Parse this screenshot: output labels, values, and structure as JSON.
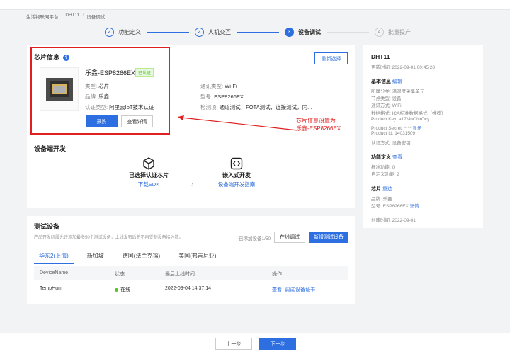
{
  "breadcrumb": [
    "生活物联网平台",
    "DHT11",
    "设备调试"
  ],
  "steps": [
    {
      "label": "功能定义",
      "num": "✓"
    },
    {
      "label": "人机交互",
      "num": "✓"
    },
    {
      "label": "设备调试",
      "num": "3"
    },
    {
      "label": "批量投产",
      "num": "4"
    }
  ],
  "chip": {
    "title": "芯片信息",
    "name": "乐鑫-ESP8266EX",
    "badge": "已认证",
    "type": "类型: ",
    "type_v": "芯片",
    "brand": "品牌: ",
    "brand_v": "乐鑫",
    "cert": "认证类型: ",
    "cert_v": "阿里云IoT技术认证",
    "comm": "通讯类型: ",
    "comm_v": "Wi-Fi",
    "model": "型号: ",
    "model_v": "ESP8266EX",
    "test": "检测项: ",
    "test_v": "通道测试，FOTA测试，连接测试，内...",
    "buy": "采购",
    "detail": "查看详情",
    "reselect": "重新选择"
  },
  "annotation": [
    "芯片信息设置为",
    "乐鑫-ESP8266EX"
  ],
  "dev": {
    "title": "设备端开发",
    "opt1_title": "已选择认证芯片",
    "opt1_link": "下载SDK",
    "opt2_title": "嵌入式开发",
    "opt2_link": "设备端开发指南"
  },
  "test": {
    "title": "测试设备",
    "desc": "产品开发阶段允许添加最多50个测试设备，上线发布后将不再受制设备接入数。",
    "count": "已添加设备1/50",
    "online_btn": "在线调试",
    "add_btn": "新增测试设备",
    "tabs": [
      "华东2(上海)",
      "新加坡",
      "德国(法兰克福)",
      "美国(弗吉尼亚)"
    ],
    "headers": [
      "DeviceName",
      "状态",
      "最后上线时间",
      "操作"
    ],
    "row": {
      "name": "TempHum",
      "status": "在线",
      "time": "2022-09-04 14:37:14",
      "ops": [
        "查看",
        "调试",
        "设备证书"
      ]
    }
  },
  "side": {
    "title": "DHT11",
    "updated": "更新时间: 2022-09-01 00:45:28",
    "basic": "基本信息",
    "edit": "编辑",
    "lines": [
      "所属分类: 温湿度采集单元",
      "节点类型: 设备",
      "通讯方式: WiFi",
      "数据格式: ICA标准数据格式（推荐）",
      "Product Key: a17MnONrOcy",
      "Product Secret: ****",
      "Product Id: 14031509",
      "认证方式: 设备密钥"
    ],
    "show": "显示",
    "func": "功能定义",
    "view": "查看",
    "func_lines": [
      "标准功能: 0",
      "自定义功能: 2"
    ],
    "chip": "芯片",
    "reselect": "重选",
    "chip_lines": [
      "品牌: 乐鑫",
      "型号: ESP8266EX"
    ],
    "detail": "详情",
    "created": "创建时间: 2022-09-01"
  },
  "footer": {
    "prev": "上一步",
    "next": "下一步"
  }
}
